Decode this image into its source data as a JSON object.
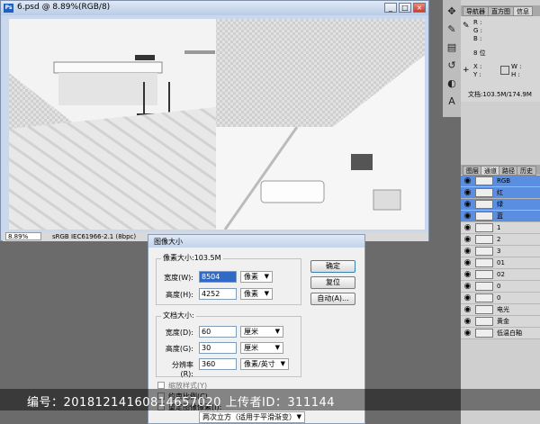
{
  "document": {
    "title": "6.psd @ 8.89%(RGB/8)",
    "ps_badge": "Ps",
    "window_buttons": [
      "_",
      "□",
      "×"
    ],
    "zoom": "8.89%",
    "profile": "sRGB IEC61966-2.1 (8bpc)"
  },
  "info_panel": {
    "tabs": [
      "导航器",
      "直方图",
      "信息"
    ],
    "rgb_labels": [
      "R :",
      "G :",
      "B :"
    ],
    "bit_depth": "8 位",
    "xy_labels": [
      "X :",
      "Y :"
    ],
    "wh_labels": [
      "W :",
      "H :"
    ],
    "doc_size": "文档:103.5M/174.9M"
  },
  "channels_panel": {
    "tabs": [
      "图层",
      "通道",
      "路径",
      "历史"
    ],
    "rows": [
      {
        "name": "RGB",
        "selected": true
      },
      {
        "name": "红",
        "selected": true
      },
      {
        "name": "绿",
        "selected": true
      },
      {
        "name": "蓝",
        "selected": true
      },
      {
        "name": "1",
        "selected": false
      },
      {
        "name": "2",
        "selected": false
      },
      {
        "name": "3",
        "selected": false
      },
      {
        "name": "01",
        "selected": false
      },
      {
        "name": "02",
        "selected": false
      },
      {
        "name": "0",
        "selected": false
      },
      {
        "name": "0",
        "selected": false
      },
      {
        "name": "电光",
        "selected": false
      },
      {
        "name": "黄金",
        "selected": false
      },
      {
        "name": "低温白釉",
        "selected": false
      }
    ]
  },
  "dialog": {
    "title": "图像大小",
    "pixel_size_label": "像素大小:103.5M",
    "width_label": "宽度(W):",
    "width_value": "8504",
    "width_unit": "像素",
    "height_label": "高度(H):",
    "height_value": "4252",
    "height_unit": "像素",
    "doc_size_label": "文档大小:",
    "doc_width_label": "宽度(D):",
    "doc_width_value": "60",
    "doc_width_unit": "厘米",
    "doc_height_label": "高度(G):",
    "doc_height_value": "30",
    "doc_height_unit": "厘米",
    "resolution_label": "分辨率(R):",
    "resolution_value": "360",
    "resolution_unit": "像素/英寸",
    "scale_styles": "缩放样式(Y)",
    "constrain": "约束比例(C)",
    "resample": "重定图像像素(I):",
    "resample_method": "两次立方（适用于平滑渐变）",
    "ok": "确定",
    "reset": "复位",
    "auto": "自动(A)..."
  },
  "watermark": "编号：20181214160814657020 上传者ID：311144"
}
